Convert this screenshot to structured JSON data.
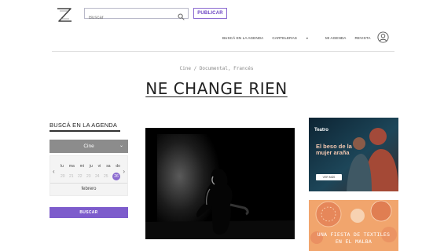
{
  "header": {
    "logo_icon": "z-logo-icon",
    "search": {
      "placeholder": "Buscar",
      "icon": "search-icon"
    },
    "publish_label": "PUBLICAR",
    "user_icon": "user-icon"
  },
  "nav": {
    "items": [
      {
        "label": "BUSCÁ EN LA AGENDA"
      },
      {
        "label": "CARTELERAS"
      },
      {
        "label": "MI AGENDA"
      },
      {
        "label": "REVISTA"
      }
    ]
  },
  "page": {
    "breadcrumb": "Cine / Documental, Francés",
    "title": "NE CHANGE RIEN"
  },
  "sidebar": {
    "heading": "BUSCÁ EN LA AGENDA",
    "category_value": "Cine",
    "calendar": {
      "weekdays": [
        "lu",
        "ma",
        "mi",
        "ju",
        "vi",
        "sa",
        "do"
      ],
      "dates": [
        "20",
        "21",
        "22",
        "23",
        "24",
        "25",
        "26"
      ],
      "selected_date": "26",
      "month": "febrero"
    },
    "search_button": "BUSCAR"
  },
  "ads": {
    "ad1": {
      "label": "Teatro",
      "text": "El beso de la mujer araña",
      "button": "VER MÁS"
    },
    "ad2": {
      "text_line1": "UNA FIESTA DE TEXTILES",
      "text_line2": "EN EL MALBA"
    }
  },
  "colors": {
    "accent": "#7d5ccc",
    "select_bg": "#8c8c8c"
  }
}
